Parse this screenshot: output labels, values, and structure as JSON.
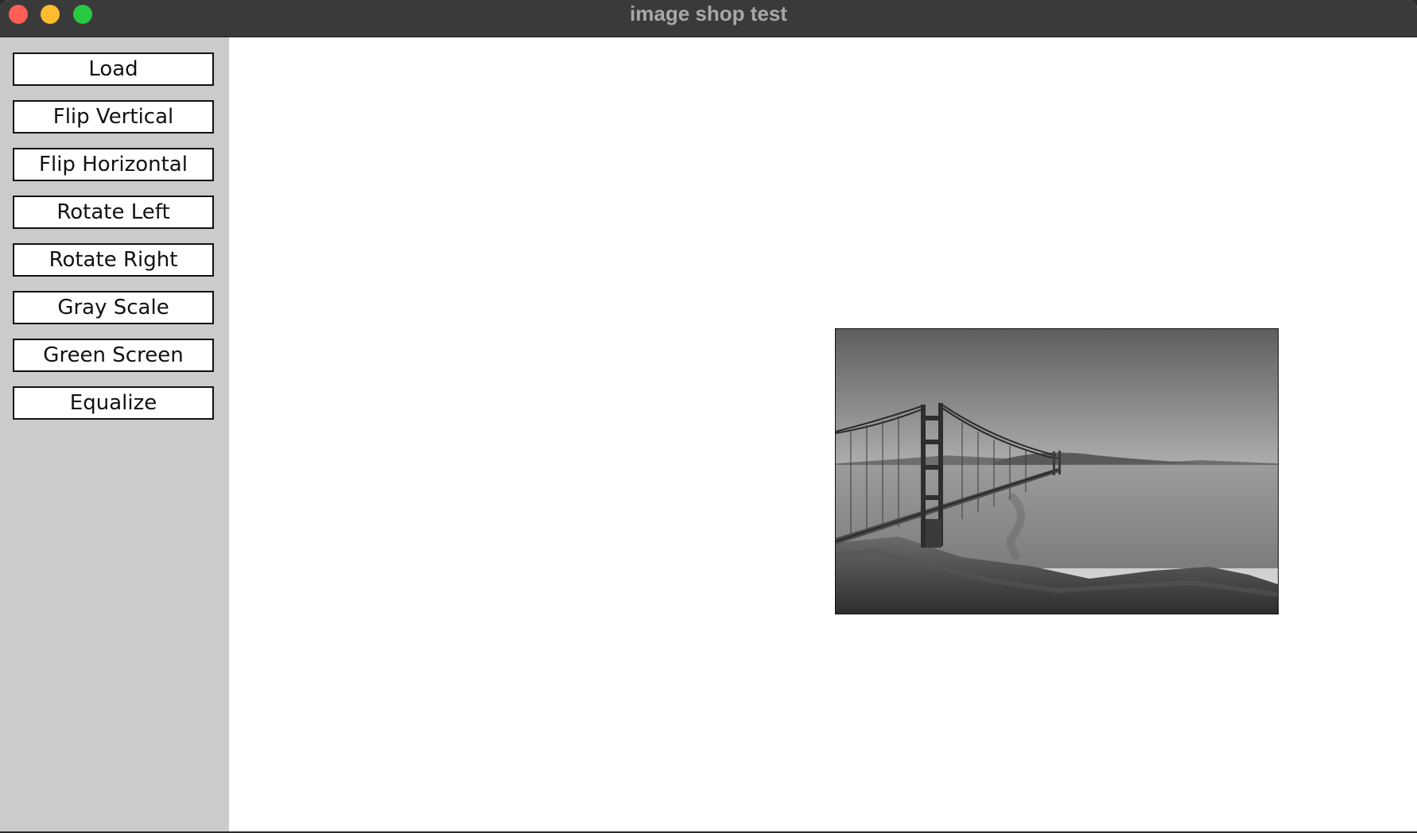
{
  "window": {
    "title": "image shop test"
  },
  "sidebar": {
    "buttons": [
      {
        "label": "Load"
      },
      {
        "label": "Flip Vertical"
      },
      {
        "label": "Flip Horizontal"
      },
      {
        "label": "Rotate Left"
      },
      {
        "label": "Rotate Right"
      },
      {
        "label": "Gray Scale"
      },
      {
        "label": "Green Screen"
      },
      {
        "label": "Equalize"
      }
    ]
  },
  "colors": {
    "titlebar": "#3a3a3a",
    "sidebar": "#cbcbcb",
    "close": "#fe5f57",
    "minimize": "#febc2e",
    "maximize": "#28c840"
  },
  "canvas": {
    "image": {
      "subject": "grayscale photo of a suspension bridge over a bay"
    }
  }
}
